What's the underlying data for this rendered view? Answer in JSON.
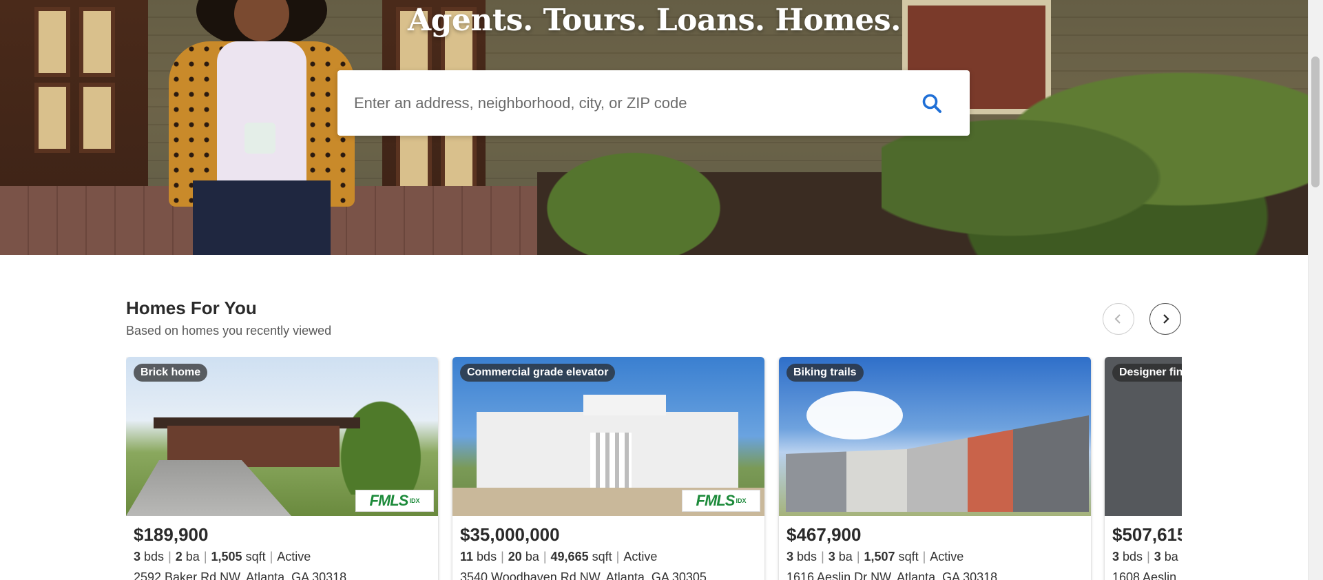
{
  "hero": {
    "headline": "Agents. Tours. Loans. Homes.",
    "search_placeholder": "Enter an address, neighborhood, city, or ZIP code",
    "search_value": "",
    "search_icon": "search-icon",
    "accent_color": "#1f6fd6"
  },
  "homes_for_you": {
    "title": "Homes For You",
    "subtitle": "Based on homes you recently viewed",
    "prev_icon": "chevron-left-icon",
    "next_icon": "chevron-right-icon",
    "cards": [
      {
        "tag": "Brick home",
        "price": "$189,900",
        "beds": "3",
        "beds_label": "bds",
        "baths": "2",
        "baths_label": "ba",
        "sqft": "1,505",
        "sqft_label": "sqft",
        "status": "Active",
        "address": "2592 Baker Rd NW, Atlanta, GA 30318",
        "badge": "FMLS",
        "badge_sup": "IDX"
      },
      {
        "tag": "Commercial grade elevator",
        "price": "$35,000,000",
        "beds": "11",
        "beds_label": "bds",
        "baths": "20",
        "baths_label": "ba",
        "sqft": "49,665",
        "sqft_label": "sqft",
        "status": "Active",
        "address": "3540 Woodhaven Rd NW, Atlanta, GA 30305",
        "badge": "FMLS",
        "badge_sup": "IDX"
      },
      {
        "tag": "Biking trails",
        "price": "$467,900",
        "beds": "3",
        "beds_label": "bds",
        "baths": "3",
        "baths_label": "ba",
        "sqft": "1,507",
        "sqft_label": "sqft",
        "status": "Active",
        "address": "1616 Aeslin Dr NW, Atlanta, GA 30318"
      },
      {
        "tag": "Designer fin",
        "price": "$507,615",
        "beds": "3",
        "beds_label": "bds",
        "baths": "3",
        "baths_label": "ba",
        "address": "1608 Aeslin"
      }
    ]
  }
}
